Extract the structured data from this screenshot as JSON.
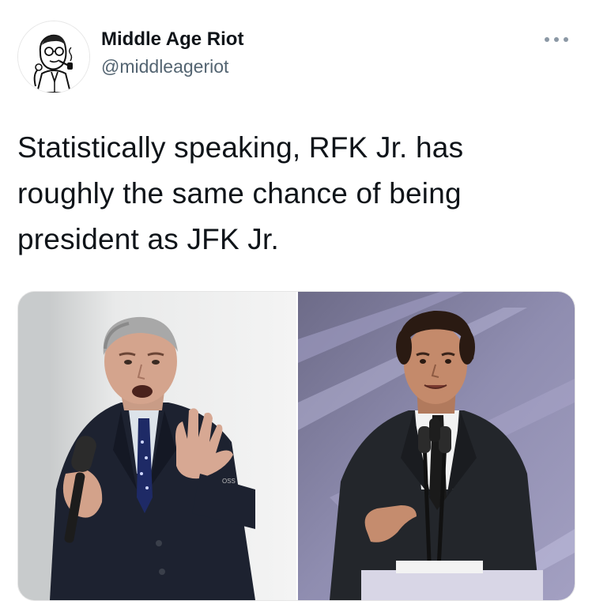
{
  "author": {
    "display_name": "Middle Age Riot",
    "handle": "@middleageriot",
    "avatar_icon": "cartoon-man-with-pipe-icon"
  },
  "more_icon": "ellipsis-icon",
  "tweet": {
    "text_lines": [
      "Statistically speaking, RFK Jr. has",
      "roughly the same chance of being",
      "president as JFK Jr."
    ]
  },
  "media": {
    "left_photo": {
      "microphone_mark": "OSS"
    }
  },
  "colors": {
    "text_primary": "#0f1419",
    "text_secondary": "#536471",
    "background": "#ffffff"
  }
}
